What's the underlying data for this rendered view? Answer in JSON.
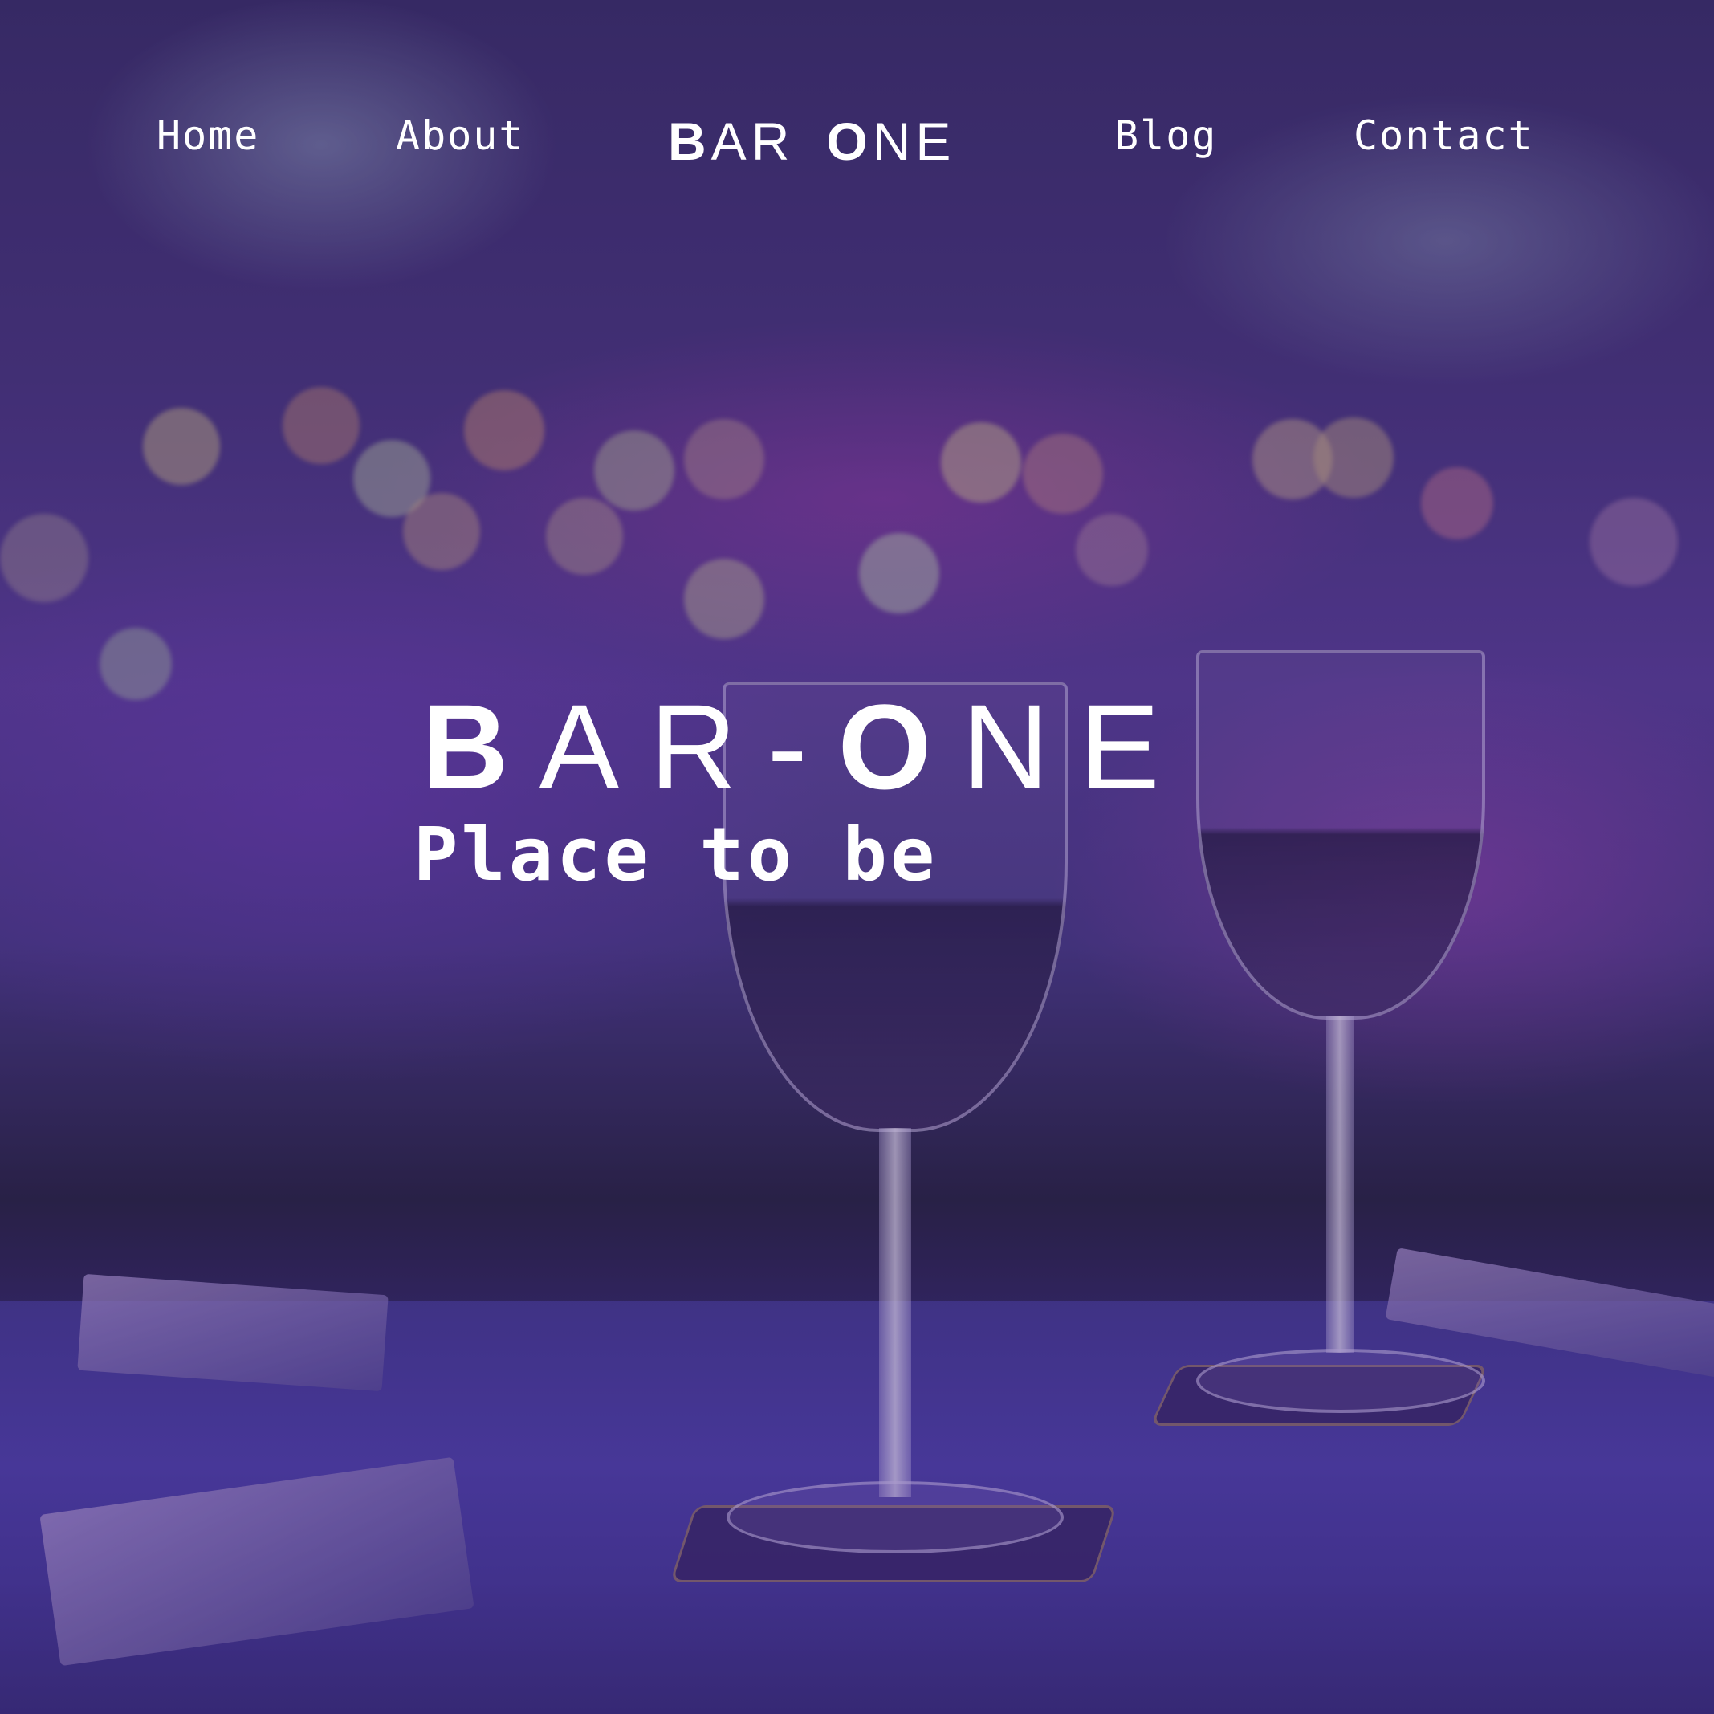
{
  "nav": {
    "items": [
      {
        "label": "Home"
      },
      {
        "label": "About"
      },
      {
        "label": "Blog"
      },
      {
        "label": "Contact"
      }
    ],
    "logo": {
      "first_letter": "B",
      "first_rest": "AR",
      "second_letter": "O",
      "second_rest": "NE"
    }
  },
  "hero": {
    "title": {
      "first_letter": "B",
      "first_rest": "AR",
      "separator": "-",
      "second_letter": "O",
      "second_rest": "NE"
    },
    "tagline": "Place to be"
  },
  "colors": {
    "text": "#ffffff",
    "overlay": "#2a2450"
  }
}
